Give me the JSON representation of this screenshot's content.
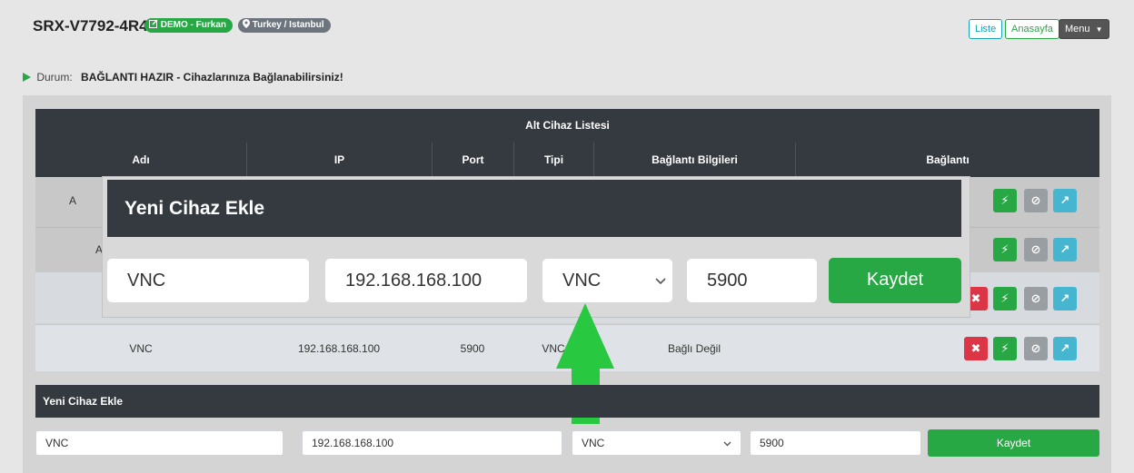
{
  "header": {
    "device_id": "SRX-V7792-4R4K4",
    "demo_badge": "DEMO - Furkan",
    "location_badge": "Turkey / Istanbul",
    "btn_liste": "Liste",
    "btn_anasayfa": "Anasayfa",
    "btn_menu": "Menu"
  },
  "status": {
    "label": "Durum:",
    "value": "BAĞLANTI HAZIR - Cihazlarınıza Bağlanabilirsiniz!"
  },
  "table": {
    "title": "Alt Cihaz Listesi",
    "columns": [
      "Adı",
      "IP",
      "Port",
      "Tipi",
      "Bağlantı Bilgileri",
      "Bağlantı"
    ],
    "row_partial_1": "A",
    "row_partial_2": "A",
    "row4": {
      "name": "VNC",
      "ip": "192.168.168.100",
      "port": "5900",
      "type": "VNC",
      "info": "Bağlı Değil"
    }
  },
  "modal": {
    "title": "Yeni Cihaz Ekle",
    "name_value": "VNC",
    "ip_value": "192.168.168.100",
    "type_value": "VNC",
    "port_value": "5900",
    "save_label": "Kaydet"
  },
  "form": {
    "title": "Yeni Cihaz Ekle",
    "name_value": "VNC",
    "ip_value": "192.168.168.100",
    "type_value": "VNC",
    "port_value": "5900",
    "save_label": "Kaydet"
  },
  "icons": {
    "delete": "✖",
    "connect": "⚡",
    "disable": "⊘",
    "open": "↗",
    "chevron": "⌄",
    "location_pin": "pin-icon",
    "edit": "edit-icon",
    "play": "play-icon"
  },
  "colors": {
    "dark": "#343a40",
    "green": "#28a745",
    "red": "#dc3545",
    "cyan": "#46b5cf",
    "gray": "#999ea3",
    "arrow": "#28c840"
  }
}
